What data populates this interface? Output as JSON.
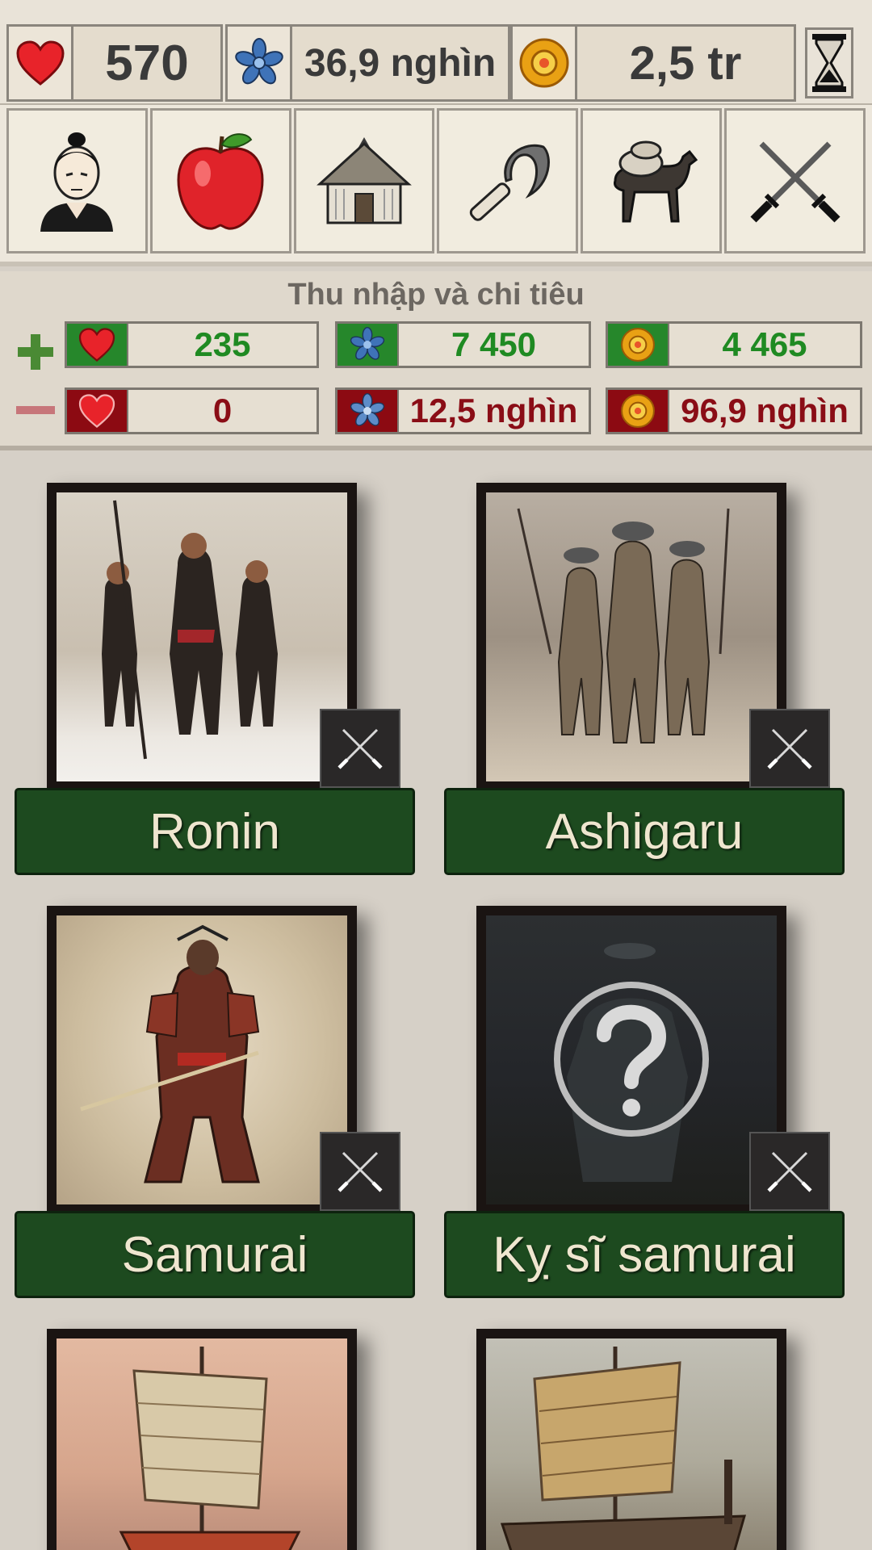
{
  "resources": {
    "hearts": "570",
    "flowers": "36,9 nghìn",
    "coins": "2,5 tr"
  },
  "nav": [
    {
      "name": "leader-icon"
    },
    {
      "name": "apple-icon"
    },
    {
      "name": "house-icon"
    },
    {
      "name": "sickle-icon"
    },
    {
      "name": "pack-horse-icon"
    },
    {
      "name": "crossed-swords-icon"
    }
  ],
  "income": {
    "title": "Thu nhập và chi tiêu",
    "plus": {
      "hearts": "235",
      "flowers": "7 450",
      "coins": "4 465"
    },
    "minus": {
      "hearts": "0",
      "flowers": "12,5 nghìn",
      "coins": "96,9 nghìn"
    }
  },
  "units": [
    {
      "name": "Ronin"
    },
    {
      "name": "Ashigaru"
    },
    {
      "name": "Samurai"
    },
    {
      "name": "Kỵ sĩ samurai"
    }
  ],
  "colors": {
    "green_bar": "#1d4a1f",
    "income_green": "#1f8a22",
    "expense_red": "#8a0d16"
  }
}
